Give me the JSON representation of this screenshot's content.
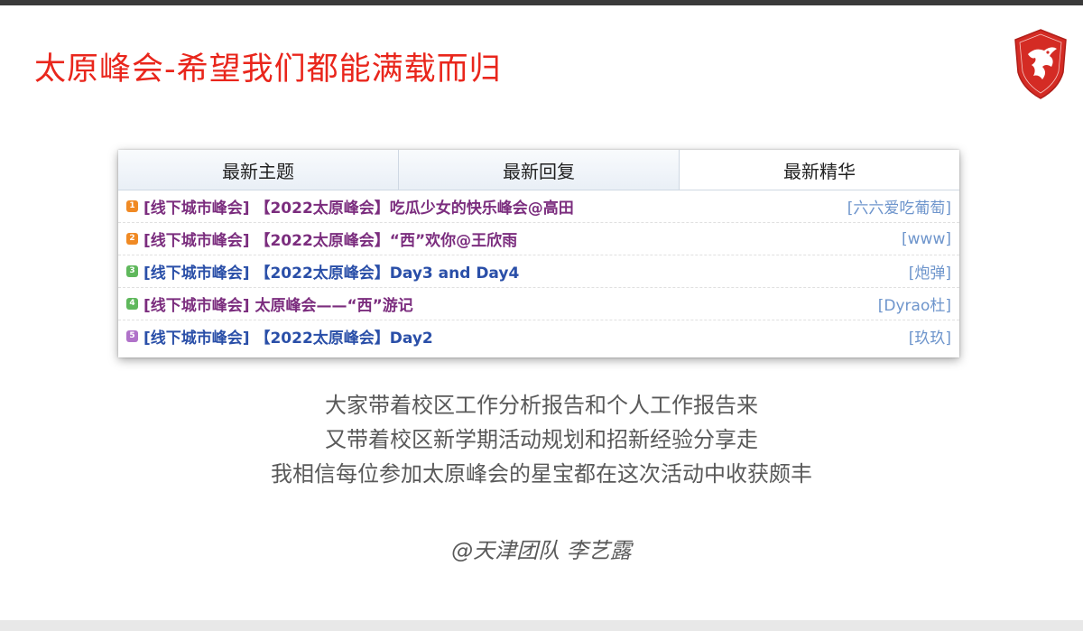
{
  "slide": {
    "title": "太原峰会-希望我们都能满载而归",
    "logo_icon": "msi-dragon-shield-icon"
  },
  "forum": {
    "tabs": [
      {
        "label": "最新主题",
        "active": false
      },
      {
        "label": "最新回复",
        "active": false
      },
      {
        "label": "最新精华",
        "active": true
      }
    ],
    "threads": [
      {
        "rank": "1",
        "rank_color": "#f08a24",
        "title": "[线下城市峰会] 【2022太原峰会】吃瓜少女的快乐峰会@高田",
        "title_color": "#7b2d7e",
        "author": "[六六爱吃葡萄]"
      },
      {
        "rank": "2",
        "rank_color": "#f08a24",
        "title": "[线下城市峰会] 【2022太原峰会】“西”欢你@王欣雨",
        "title_color": "#7b2d7e",
        "author": "[www]"
      },
      {
        "rank": "3",
        "rank_color": "#5fb85c",
        "title": "[线下城市峰会] 【2022太原峰会】Day3 and Day4",
        "title_color": "#2a4fa8",
        "author": "[炮弹]"
      },
      {
        "rank": "4",
        "rank_color": "#5fb85c",
        "title": "[线下城市峰会] 太原峰会——“西”游记",
        "title_color": "#7b2d7e",
        "author": "[Dyrao杜]"
      },
      {
        "rank": "5",
        "rank_color": "#b072c9",
        "title": "[线下城市峰会] 【2022太原峰会】Day2",
        "title_color": "#2a4fa8",
        "author": "[玖玖]"
      }
    ]
  },
  "body": {
    "lines": [
      "大家带着校区工作分析报告和个人工作报告来",
      "又带着校区新学期活动规划和招新经验分享走",
      "我相信每位参加太原峰会的星宝都在这次活动中收获颇丰"
    ],
    "signature": "@天津团队 李艺露"
  }
}
